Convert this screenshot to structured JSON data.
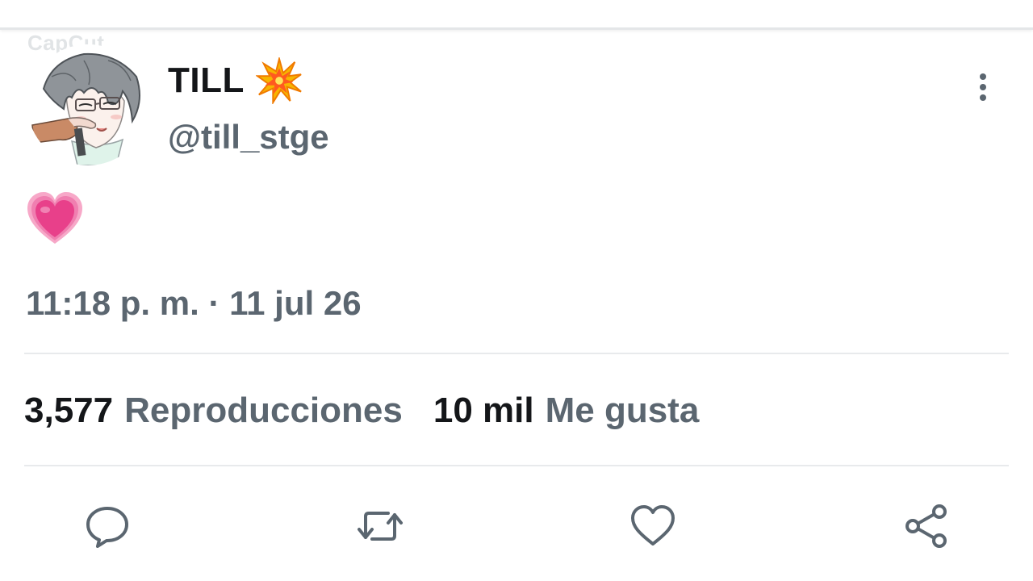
{
  "watermark": {
    "text": "CapCut"
  },
  "tweet": {
    "display_name": "TILL",
    "name_emoji_icon": "collision-emoji-icon",
    "handle": "@till_stge",
    "body_emoji_icon": "growing-heart-emoji-icon",
    "timestamp": "11:18 p. m. · 11 jul 26"
  },
  "stats": {
    "views_count": "3,577",
    "views_label": "Reproducciones",
    "likes_count": "10 mil",
    "likes_label": "Me gusta"
  },
  "actions": [
    {
      "icon": "reply-icon"
    },
    {
      "icon": "retweet-icon"
    },
    {
      "icon": "like-icon"
    },
    {
      "icon": "share-icon"
    }
  ],
  "colors": {
    "text_primary": "#141619",
    "text_secondary": "#5b6670",
    "divider": "#e8eaec",
    "heart_pink": "#e8408a"
  }
}
